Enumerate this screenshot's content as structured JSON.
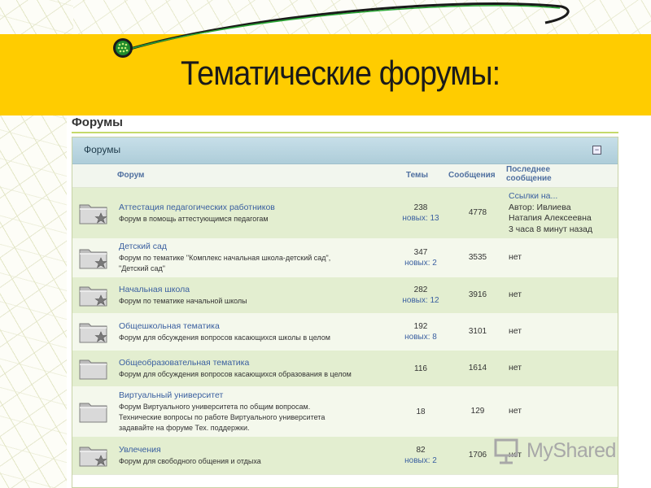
{
  "slide": {
    "title": "Тематические форумы:"
  },
  "panel": {
    "section_title": "Форумы",
    "category_title": "Форумы",
    "collapse_symbol": "−",
    "columns": {
      "forum": "Форум",
      "topics": "Темы",
      "posts": "Сообщения",
      "last_line1": "Последнее",
      "last_line2": "сообщение"
    },
    "forums": [
      {
        "title": "Аттестация педагогических работников",
        "desc": [
          "Форум в помощь аттестующимся педагогам"
        ],
        "topics": "238",
        "new": "новых: 13",
        "posts": "4778",
        "last": [
          "Ссылки на...",
          "Автор: Ивлиева",
          "Натапия Алексеевна",
          "3 часа 8 минут назад"
        ]
      },
      {
        "title": "Детский сад",
        "desc": [
          "Форум по тематике \"Комплекс начальная школа-детский сад\",",
          "\"Детский сад\""
        ],
        "topics": "347",
        "new": "новых: 2",
        "posts": "3535",
        "last": [
          "нет"
        ]
      },
      {
        "title": "Начальная школа",
        "desc": [
          "Форум по тематике начальной школы"
        ],
        "topics": "282",
        "new": "новых: 12",
        "posts": "3916",
        "last": [
          "нет"
        ]
      },
      {
        "title": "Общешкольная тематика",
        "desc": [
          "Форум для обсуждения вопросов касающихся школы в целом"
        ],
        "topics": "192",
        "new": "новых: 8",
        "posts": "3101",
        "last": [
          "нет"
        ]
      },
      {
        "title": "Общеобразовательная тематика",
        "desc": [
          "Форум для обсуждения вопросов касающихся образования в целом"
        ],
        "topics": "116",
        "new": "",
        "posts": "1614",
        "last": [
          "нет"
        ]
      },
      {
        "title": "Виртуальный университет",
        "desc": [
          "Форум Виртуального университета по общим вопросам.",
          "Технические вопросы по работе Виртуального университета",
          "задавайте на форуме Тех. поддержки."
        ],
        "topics": "18",
        "new": "",
        "posts": "129",
        "last": [
          "нет"
        ]
      },
      {
        "title": "Увлечения",
        "desc": [
          "Форум для свободного общения и отдыха"
        ],
        "topics": "82",
        "new": "новых: 2",
        "posts": "1706",
        "last": [
          "нет"
        ]
      }
    ]
  },
  "watermark": {
    "text": "MyShared"
  },
  "colors": {
    "accent_yellow": "#ffcc00",
    "row_odd": "#e3eed0",
    "row_even": "#f4f8ec",
    "link_blue": "#3a5fa0",
    "swoosh_green": "#1f8a2c"
  }
}
